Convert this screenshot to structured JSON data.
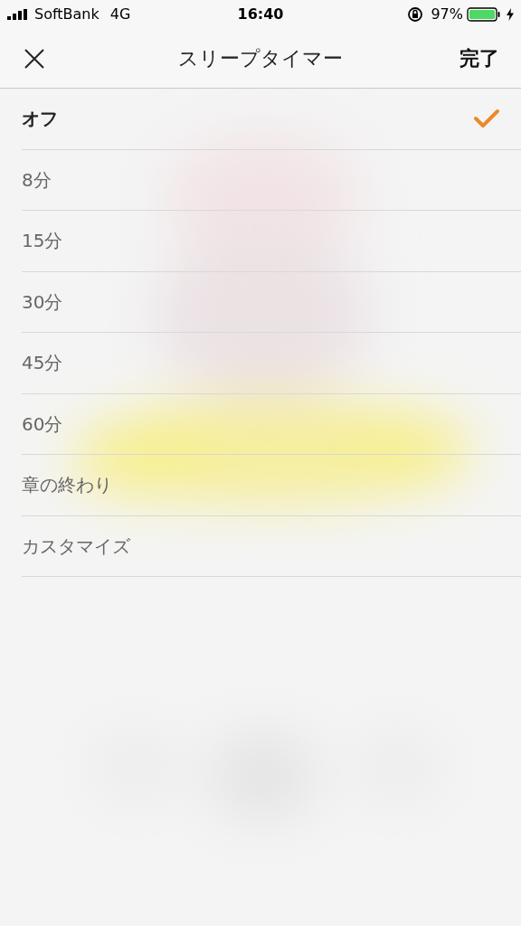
{
  "status_bar": {
    "carrier": "SoftBank",
    "network": "4G",
    "time": "16:40",
    "battery": "97%"
  },
  "header": {
    "title": "スリープタイマー",
    "done": "完了"
  },
  "options": [
    {
      "label": "オフ",
      "selected": true
    },
    {
      "label": "8分",
      "selected": false
    },
    {
      "label": "15分",
      "selected": false
    },
    {
      "label": "30分",
      "selected": false
    },
    {
      "label": "45分",
      "selected": false
    },
    {
      "label": "60分",
      "selected": false
    },
    {
      "label": "章の終わり",
      "selected": false
    },
    {
      "label": "カスタマイズ",
      "selected": false
    }
  ]
}
